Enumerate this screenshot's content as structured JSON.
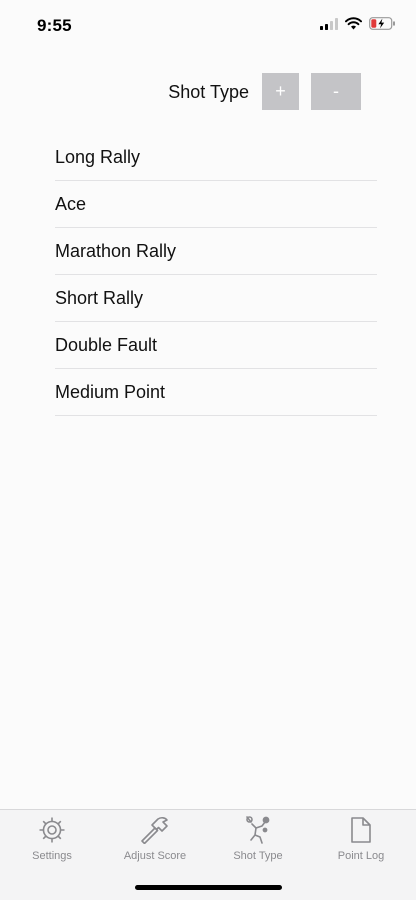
{
  "status_bar": {
    "time": "9:55",
    "icons": [
      "cellular-signal-icon",
      "wifi-icon",
      "battery-charging-icon"
    ],
    "battery_color": "#e03a3a"
  },
  "header": {
    "title": "Shot Type",
    "add_label": "+",
    "remove_label": "-",
    "button_color": "#c4c4c7"
  },
  "shot_types": [
    "Long Rally",
    "Ace",
    "Marathon Rally",
    "Short Rally",
    "Double Fault",
    "Medium Point"
  ],
  "tabs": [
    {
      "label": "Settings",
      "icon": "gear-icon"
    },
    {
      "label": "Adjust Score",
      "icon": "hammer-icon"
    },
    {
      "label": "Shot Type",
      "icon": "tennis-player-icon"
    },
    {
      "label": "Point Log",
      "icon": "document-icon"
    }
  ]
}
